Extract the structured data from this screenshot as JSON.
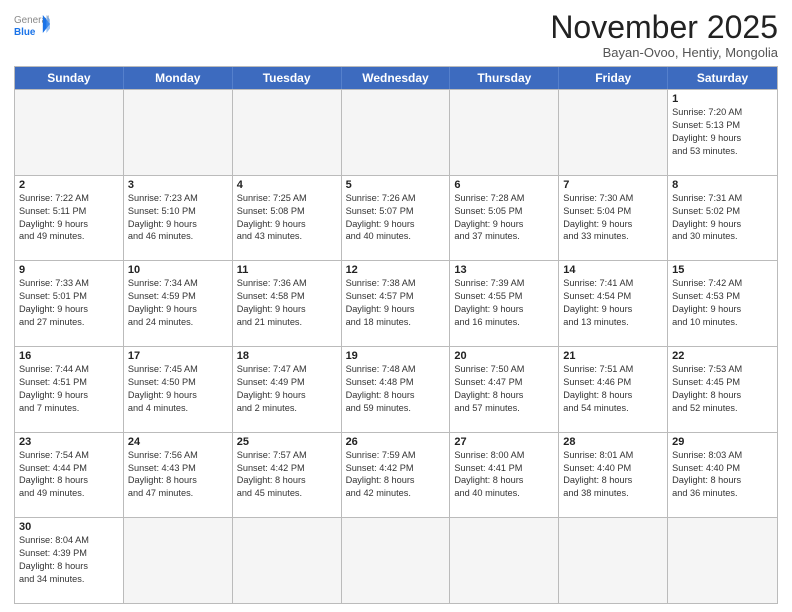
{
  "header": {
    "logo_general": "General",
    "logo_blue": "Blue",
    "month": "November 2025",
    "location": "Bayan-Ovoo, Hentiy, Mongolia"
  },
  "weekdays": [
    "Sunday",
    "Monday",
    "Tuesday",
    "Wednesday",
    "Thursday",
    "Friday",
    "Saturday"
  ],
  "rows": [
    [
      {
        "day": "",
        "info": ""
      },
      {
        "day": "",
        "info": ""
      },
      {
        "day": "",
        "info": ""
      },
      {
        "day": "",
        "info": ""
      },
      {
        "day": "",
        "info": ""
      },
      {
        "day": "",
        "info": ""
      },
      {
        "day": "1",
        "info": "Sunrise: 7:20 AM\nSunset: 5:13 PM\nDaylight: 9 hours\nand 53 minutes."
      }
    ],
    [
      {
        "day": "2",
        "info": "Sunrise: 7:22 AM\nSunset: 5:11 PM\nDaylight: 9 hours\nand 49 minutes."
      },
      {
        "day": "3",
        "info": "Sunrise: 7:23 AM\nSunset: 5:10 PM\nDaylight: 9 hours\nand 46 minutes."
      },
      {
        "day": "4",
        "info": "Sunrise: 7:25 AM\nSunset: 5:08 PM\nDaylight: 9 hours\nand 43 minutes."
      },
      {
        "day": "5",
        "info": "Sunrise: 7:26 AM\nSunset: 5:07 PM\nDaylight: 9 hours\nand 40 minutes."
      },
      {
        "day": "6",
        "info": "Sunrise: 7:28 AM\nSunset: 5:05 PM\nDaylight: 9 hours\nand 37 minutes."
      },
      {
        "day": "7",
        "info": "Sunrise: 7:30 AM\nSunset: 5:04 PM\nDaylight: 9 hours\nand 33 minutes."
      },
      {
        "day": "8",
        "info": "Sunrise: 7:31 AM\nSunset: 5:02 PM\nDaylight: 9 hours\nand 30 minutes."
      }
    ],
    [
      {
        "day": "9",
        "info": "Sunrise: 7:33 AM\nSunset: 5:01 PM\nDaylight: 9 hours\nand 27 minutes."
      },
      {
        "day": "10",
        "info": "Sunrise: 7:34 AM\nSunset: 4:59 PM\nDaylight: 9 hours\nand 24 minutes."
      },
      {
        "day": "11",
        "info": "Sunrise: 7:36 AM\nSunset: 4:58 PM\nDaylight: 9 hours\nand 21 minutes."
      },
      {
        "day": "12",
        "info": "Sunrise: 7:38 AM\nSunset: 4:57 PM\nDaylight: 9 hours\nand 18 minutes."
      },
      {
        "day": "13",
        "info": "Sunrise: 7:39 AM\nSunset: 4:55 PM\nDaylight: 9 hours\nand 16 minutes."
      },
      {
        "day": "14",
        "info": "Sunrise: 7:41 AM\nSunset: 4:54 PM\nDaylight: 9 hours\nand 13 minutes."
      },
      {
        "day": "15",
        "info": "Sunrise: 7:42 AM\nSunset: 4:53 PM\nDaylight: 9 hours\nand 10 minutes."
      }
    ],
    [
      {
        "day": "16",
        "info": "Sunrise: 7:44 AM\nSunset: 4:51 PM\nDaylight: 9 hours\nand 7 minutes."
      },
      {
        "day": "17",
        "info": "Sunrise: 7:45 AM\nSunset: 4:50 PM\nDaylight: 9 hours\nand 4 minutes."
      },
      {
        "day": "18",
        "info": "Sunrise: 7:47 AM\nSunset: 4:49 PM\nDaylight: 9 hours\nand 2 minutes."
      },
      {
        "day": "19",
        "info": "Sunrise: 7:48 AM\nSunset: 4:48 PM\nDaylight: 8 hours\nand 59 minutes."
      },
      {
        "day": "20",
        "info": "Sunrise: 7:50 AM\nSunset: 4:47 PM\nDaylight: 8 hours\nand 57 minutes."
      },
      {
        "day": "21",
        "info": "Sunrise: 7:51 AM\nSunset: 4:46 PM\nDaylight: 8 hours\nand 54 minutes."
      },
      {
        "day": "22",
        "info": "Sunrise: 7:53 AM\nSunset: 4:45 PM\nDaylight: 8 hours\nand 52 minutes."
      }
    ],
    [
      {
        "day": "23",
        "info": "Sunrise: 7:54 AM\nSunset: 4:44 PM\nDaylight: 8 hours\nand 49 minutes."
      },
      {
        "day": "24",
        "info": "Sunrise: 7:56 AM\nSunset: 4:43 PM\nDaylight: 8 hours\nand 47 minutes."
      },
      {
        "day": "25",
        "info": "Sunrise: 7:57 AM\nSunset: 4:42 PM\nDaylight: 8 hours\nand 45 minutes."
      },
      {
        "day": "26",
        "info": "Sunrise: 7:59 AM\nSunset: 4:42 PM\nDaylight: 8 hours\nand 42 minutes."
      },
      {
        "day": "27",
        "info": "Sunrise: 8:00 AM\nSunset: 4:41 PM\nDaylight: 8 hours\nand 40 minutes."
      },
      {
        "day": "28",
        "info": "Sunrise: 8:01 AM\nSunset: 4:40 PM\nDaylight: 8 hours\nand 38 minutes."
      },
      {
        "day": "29",
        "info": "Sunrise: 8:03 AM\nSunset: 4:40 PM\nDaylight: 8 hours\nand 36 minutes."
      }
    ],
    [
      {
        "day": "30",
        "info": "Sunrise: 8:04 AM\nSunset: 4:39 PM\nDaylight: 8 hours\nand 34 minutes."
      },
      {
        "day": "",
        "info": ""
      },
      {
        "day": "",
        "info": ""
      },
      {
        "day": "",
        "info": ""
      },
      {
        "day": "",
        "info": ""
      },
      {
        "day": "",
        "info": ""
      },
      {
        "day": "",
        "info": ""
      }
    ]
  ]
}
